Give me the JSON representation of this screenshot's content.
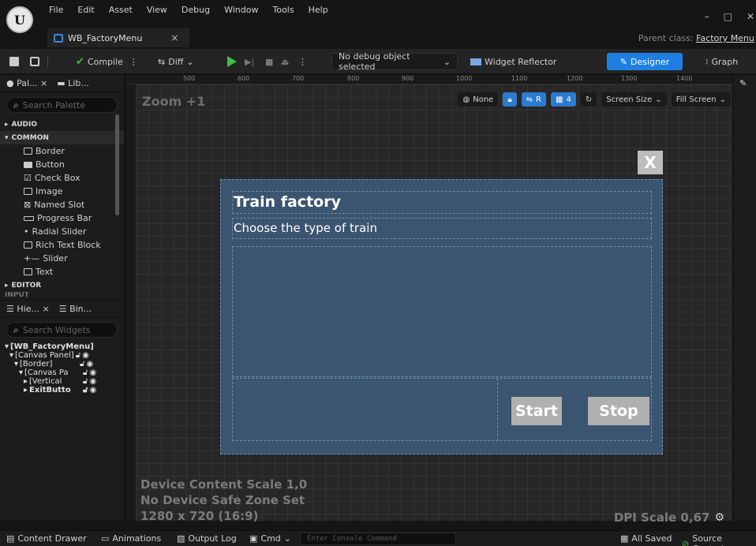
{
  "menu": [
    "File",
    "Edit",
    "Asset",
    "View",
    "Debug",
    "Window",
    "Tools",
    "Help"
  ],
  "doc_tab": {
    "title": "WB_FactoryMenu",
    "close": "×"
  },
  "window": {
    "minimize": "–",
    "maximize": "□",
    "close": "✕",
    "parent_class_label": "Parent class:",
    "parent_class_value": "Factory Menu"
  },
  "toolbar": {
    "compile": "Compile",
    "diff": "Diff",
    "debug_select": "No debug object selected",
    "widget_reflector": "Widget Reflector",
    "designer": "Designer",
    "graph": "Graph"
  },
  "palette": {
    "tabs": [
      "Pal...",
      "Lib..."
    ],
    "search_placeholder": "Search Palette",
    "categories": {
      "audio": "AUDIO",
      "common": "COMMON",
      "editor": "EDITOR",
      "input": "INPUT"
    },
    "items": [
      "Border",
      "Button",
      "Check Box",
      "Image",
      "Named Slot",
      "Progress Bar",
      "Radial Slider",
      "Rich Text Block",
      "Slider",
      "Text"
    ]
  },
  "hierarchy": {
    "tabs": [
      "Hie...",
      "Bin..."
    ],
    "search_placeholder": "Search Widgets",
    "items": [
      "[WB_FactoryMenu]",
      "[Canvas Panel]",
      "[Border]",
      "[Canvas Pa",
      "[Vertical",
      "ExitButto"
    ]
  },
  "ruler": {
    "top": [
      "500",
      "600",
      "700",
      "800",
      "900",
      "1000",
      "1100",
      "1200",
      "1300",
      "1400"
    ]
  },
  "canvas": {
    "zoom": "Zoom +1",
    "toolbar": {
      "none": "None",
      "r": "R",
      "grid": "4",
      "screen_size": "Screen Size",
      "fill_screen": "Fill Screen"
    },
    "device_content_scale": "Device Content Scale 1,0",
    "safe_zone": "No Device Safe Zone Set",
    "resolution": "1280 x 720 (16:9)",
    "dpi_scale": "DPI Scale 0,67"
  },
  "widget": {
    "exit_label": "X",
    "title": "Train factory",
    "subtitle": "Choose the type of train",
    "start": "Start",
    "stop": "Stop"
  },
  "statusbar": {
    "content_drawer": "Content Drawer",
    "animations": "Animations",
    "output_log": "Output Log",
    "cmd": "Cmd",
    "console_placeholder": "Enter Console Command",
    "all_saved": "All Saved",
    "source_control": "Source Control"
  },
  "colors": {
    "accent": "#1f7fe0",
    "widget_bg": "#3b5470",
    "button_grey": "#b0b0b0"
  }
}
